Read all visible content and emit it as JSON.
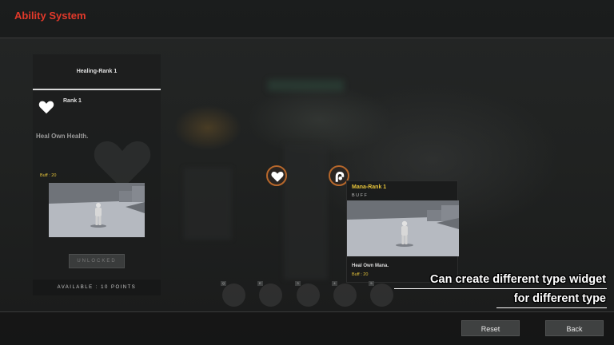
{
  "app": {
    "title": "Ability System"
  },
  "left_panel": {
    "title": "Healing-Rank 1",
    "rank_label": "Rank 1",
    "description": "Heal Own Health.",
    "buff": "Buff : 20",
    "unlock_button": "UNLOCKED",
    "available_points": "AVAILABLE : 10 POINTS",
    "icon": "heart-icon"
  },
  "ability_nodes": [
    {
      "name": "healing",
      "icon": "heart-icon"
    },
    {
      "name": "mana",
      "icon": "hand-icon"
    }
  ],
  "tooltip": {
    "title": "Mana-Rank 1",
    "type": "BUFF",
    "description": "Heal Own Mana.",
    "buff": "Buff : 20"
  },
  "hotkeys": [
    "Q",
    "E",
    "3",
    "4",
    "5"
  ],
  "caption": {
    "line1": "Can create different type widget",
    "line2": "for different type"
  },
  "footer": {
    "reset_label": "Reset",
    "back_label": "Back"
  },
  "colors": {
    "title_accent": "#e2392a",
    "buff_text": "#e5c33a",
    "node_border": "#b6672b"
  }
}
